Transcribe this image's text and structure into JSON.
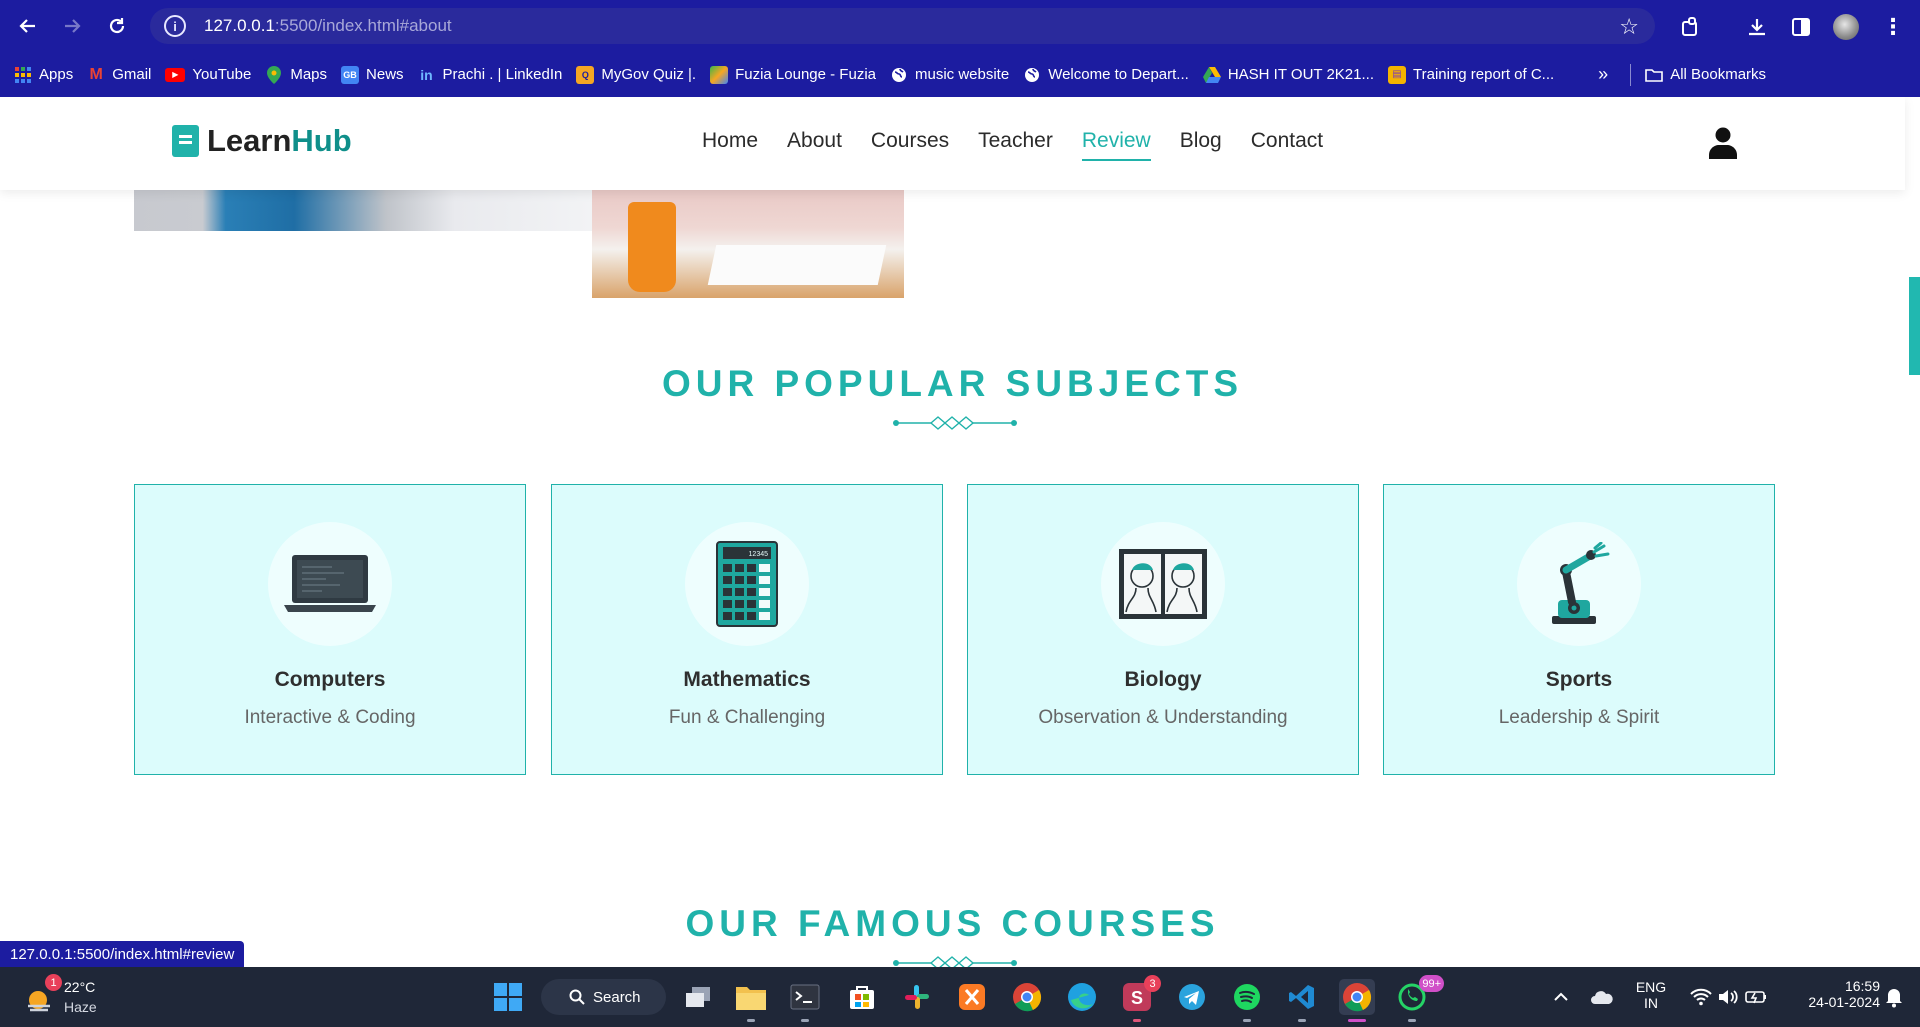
{
  "browser": {
    "url_host": "127.0.0.1",
    "url_path": ":5500/index.html#about",
    "status_url": "127.0.0.1:5500/index.html#review"
  },
  "bookmarks": [
    {
      "label": "Apps",
      "icon": "apps-grid-icon",
      "color": "#ffffff"
    },
    {
      "label": "Gmail",
      "icon": "gmail-icon",
      "color": "#ea4335"
    },
    {
      "label": "YouTube",
      "icon": "youtube-icon",
      "color": "#ff0000"
    },
    {
      "label": "Maps",
      "icon": "maps-icon",
      "color": "#34a853"
    },
    {
      "label": "News",
      "icon": "news-icon",
      "color": "#4285f4"
    },
    {
      "label": "Prachi . | LinkedIn",
      "icon": "linkedin-icon",
      "color": "#0a66c2"
    },
    {
      "label": "MyGov Quiz |.",
      "icon": "mygov-icon",
      "color": "#f6a623"
    },
    {
      "label": "Fuzia Lounge - Fuzia",
      "icon": "fuzia-icon",
      "color": "#3bb54a"
    },
    {
      "label": "music website",
      "icon": "globe-icon",
      "color": "#ffffff"
    },
    {
      "label": "Welcome to Depart...",
      "icon": "globe-icon",
      "color": "#ffffff"
    },
    {
      "label": "HASH IT OUT 2K21...",
      "icon": "drive-icon",
      "color": "#fbbc04"
    },
    {
      "label": "Training report of C...",
      "icon": "forms-icon",
      "color": "#f4b400"
    }
  ],
  "all_bookmarks": "All Bookmarks",
  "site": {
    "logo_learn": "Learn",
    "logo_hub": "Hub",
    "nav": [
      "Home",
      "About",
      "Courses",
      "Teacher",
      "Review",
      "Blog",
      "Contact"
    ],
    "active_nav": "Review",
    "accent": "#20b2aa"
  },
  "subjects": {
    "title": "OUR POPULAR SUBJECTS",
    "cards": [
      {
        "title": "Computers",
        "subtitle": "Interactive & Coding",
        "icon": "laptop-icon"
      },
      {
        "title": "Mathematics",
        "subtitle": "Fun & Challenging",
        "icon": "calculator-icon"
      },
      {
        "title": "Biology",
        "subtitle": "Observation & Understanding",
        "icon": "anatomy-icon"
      },
      {
        "title": "Sports",
        "subtitle": "Leadership & Spirit",
        "icon": "robot-arm-icon"
      }
    ],
    "calc_display": "12345"
  },
  "courses": {
    "title": "OUR FAMOUS COURSES"
  },
  "taskbar": {
    "weather_temp": "22°C",
    "weather_desc": "Haze",
    "weather_badge": "1",
    "search_label": "Search",
    "skype_badge": "3",
    "whatsapp_badge": "99+",
    "lang_top": "ENG",
    "lang_bottom": "IN",
    "time": "16:59",
    "date": "24-01-2024"
  }
}
